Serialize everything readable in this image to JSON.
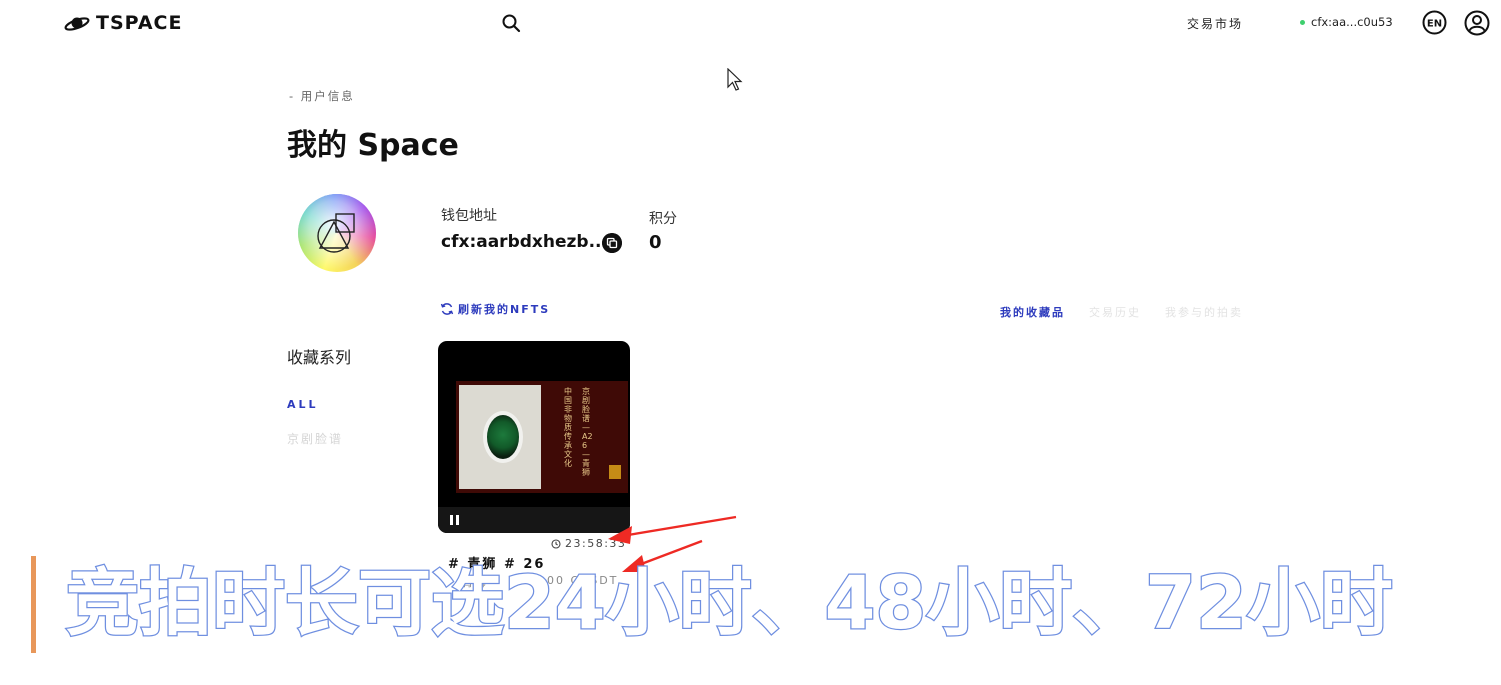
{
  "header": {
    "logo_text": "TSPACE",
    "nav_market": "交易市场",
    "wallet_short": "cfx:aa...c0u53",
    "lang_icon": "EN"
  },
  "page": {
    "breadcrumb": "- 用户信息",
    "title": "我的 Space"
  },
  "profile": {
    "wallet_label": "钱包地址",
    "wallet_address": "cfx:aarbdxhezb...",
    "points_label": "积分",
    "points_value": "0"
  },
  "refresh_label": "刷新我的NFTS",
  "tabs": [
    {
      "label": "我的收藏品",
      "active": true
    },
    {
      "label": "交易历史",
      "active": false
    },
    {
      "label": "我参与的拍卖",
      "active": false
    }
  ],
  "sidebar": {
    "title": "收藏系列",
    "filters": [
      {
        "label": "ALL",
        "active": true
      },
      {
        "label": "京剧脸谱",
        "active": false
      }
    ]
  },
  "nft": {
    "art_text_right": "京剧脸谱—A26—青狮",
    "art_text_left": "中国非物质传承文化",
    "timer": "23:58:33",
    "name": "# 青狮 # 26",
    "meta": "青狮",
    "price": "100 CUSDT"
  },
  "caption": "竞拍时长可选24小时、48小时、72小时",
  "colors": {
    "accent": "#2d3bbd",
    "caption_outline": "#6f8fe0",
    "caption_bar": "#e8975a",
    "arrow": "#ee2a24"
  }
}
